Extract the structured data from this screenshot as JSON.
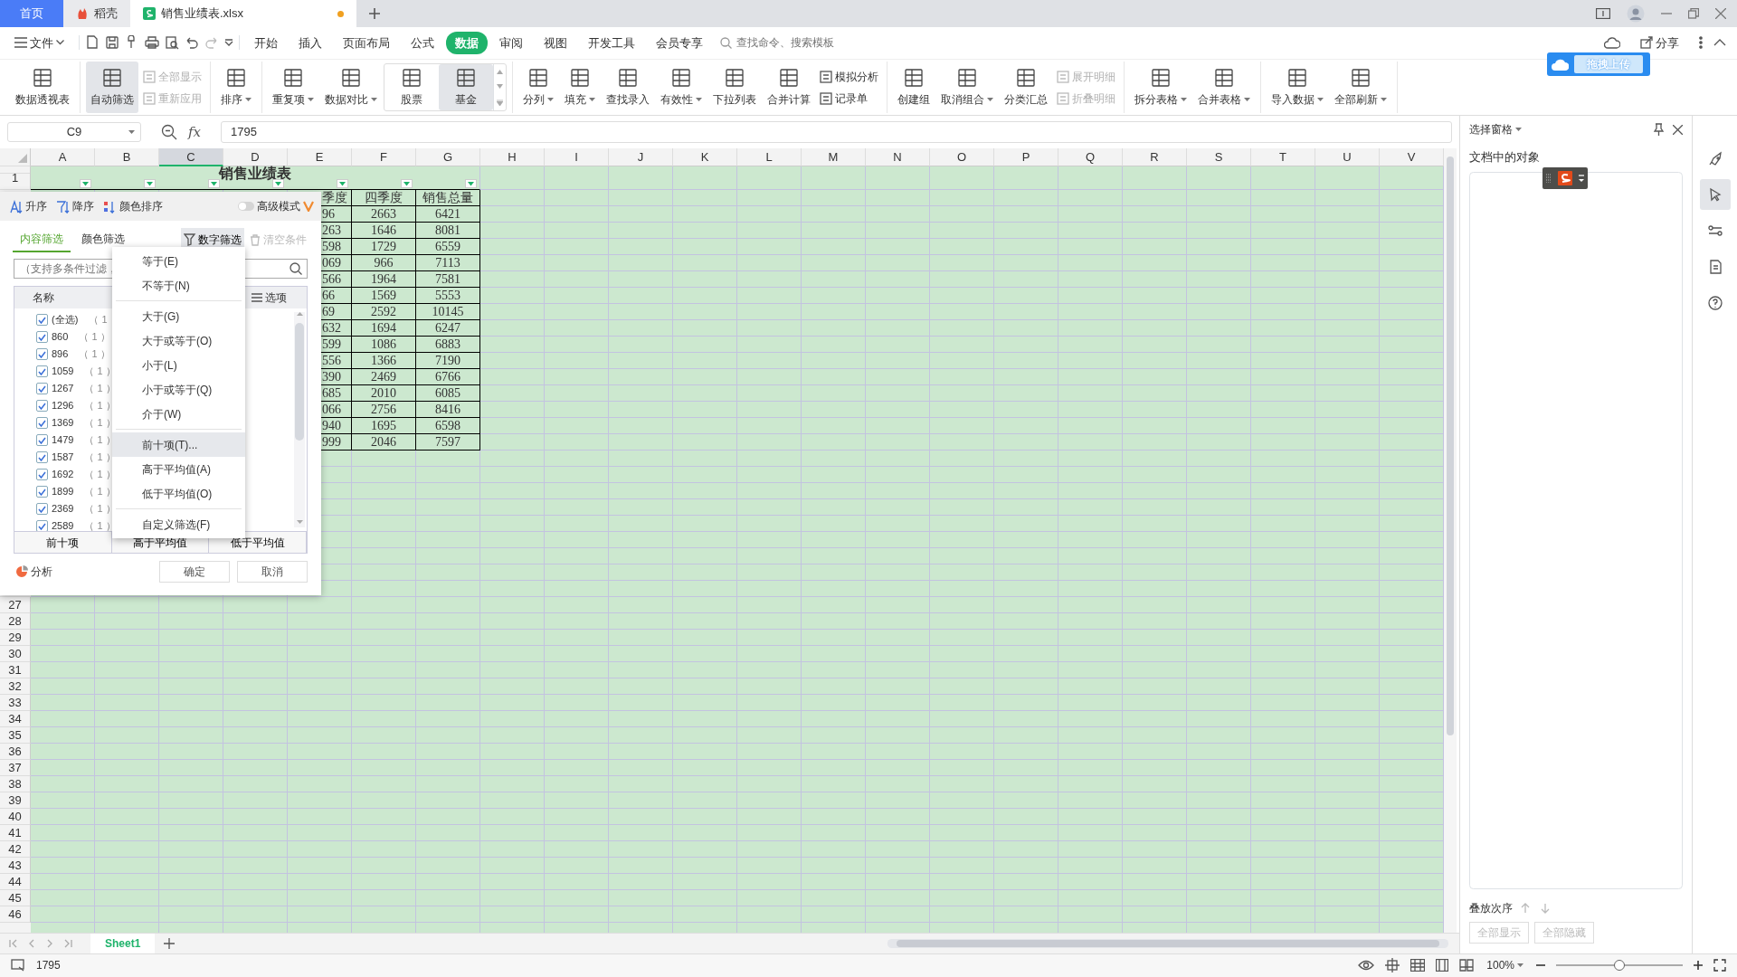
{
  "tabs": [
    {
      "label": "首页",
      "kind": "home",
      "selected": false,
      "unsaved": false
    },
    {
      "label": "稻壳",
      "kind": "docer",
      "selected": false,
      "unsaved": false
    },
    {
      "label": "销售业绩表.xlsx",
      "kind": "sheet",
      "selected": true,
      "unsaved": true
    }
  ],
  "menu": {
    "file": "文件",
    "items": [
      {
        "label": "开始",
        "selected": false
      },
      {
        "label": "插入",
        "selected": false
      },
      {
        "label": "页面布局",
        "selected": false
      },
      {
        "label": "公式",
        "selected": false
      },
      {
        "label": "数据",
        "selected": true
      },
      {
        "label": "审阅",
        "selected": false
      },
      {
        "label": "视图",
        "selected": false
      },
      {
        "label": "开发工具",
        "selected": false
      },
      {
        "label": "会员专享",
        "selected": false
      }
    ],
    "search_placeholder": "查找命令、搜索模板",
    "upload_tip": "拖拽上传",
    "share": "分享"
  },
  "ribbon": [
    [
      {
        "kind": "big",
        "label": "数据透视表",
        "dropdown": false,
        "selected": false
      }
    ],
    [
      {
        "kind": "big",
        "label": "自动筛选",
        "dropdown": false,
        "selected": true
      },
      {
        "kind": "small",
        "label": "全部显示",
        "disabled": true
      },
      {
        "kind": "small",
        "label": "重新应用",
        "disabled": true
      }
    ],
    [
      {
        "kind": "big",
        "label": "排序",
        "dropdown": true,
        "selected": false
      }
    ],
    [
      {
        "kind": "big",
        "label": "重复项",
        "dropdown": true,
        "selected": false
      },
      {
        "kind": "big",
        "label": "数据对比",
        "dropdown": true,
        "selected": false
      },
      {
        "kind": "gallery",
        "label": "股票",
        "selected": false
      },
      {
        "kind": "gallery",
        "label": "基金",
        "selected": true
      }
    ],
    [
      {
        "kind": "big",
        "label": "分列",
        "dropdown": true,
        "selected": false
      },
      {
        "kind": "big",
        "label": "填充",
        "dropdown": true,
        "selected": false
      },
      {
        "kind": "big",
        "label": "查找录入",
        "dropdown": false,
        "selected": false
      },
      {
        "kind": "big",
        "label": "有效性",
        "dropdown": true,
        "selected": false
      },
      {
        "kind": "big",
        "label": "下拉列表",
        "dropdown": false,
        "selected": false
      },
      {
        "kind": "big",
        "label": "合并计算",
        "dropdown": false,
        "selected": false
      },
      {
        "kind": "small",
        "label": "模拟分析",
        "disabled": false
      },
      {
        "kind": "small",
        "label": "记录单",
        "disabled": false
      }
    ],
    [
      {
        "kind": "big",
        "label": "创建组",
        "dropdown": false,
        "selected": false
      },
      {
        "kind": "big",
        "label": "取消组合",
        "dropdown": true,
        "selected": false
      },
      {
        "kind": "big",
        "label": "分类汇总",
        "dropdown": false,
        "selected": false
      },
      {
        "kind": "small",
        "label": "展开明细",
        "disabled": true
      },
      {
        "kind": "small",
        "label": "折叠明细",
        "disabled": true
      }
    ],
    [
      {
        "kind": "big",
        "label": "拆分表格",
        "dropdown": true,
        "selected": false
      },
      {
        "kind": "big",
        "label": "合并表格",
        "dropdown": true,
        "selected": false
      }
    ],
    [
      {
        "kind": "big",
        "label": "导入数据",
        "dropdown": true,
        "selected": false
      },
      {
        "kind": "big",
        "label": "全部刷新",
        "dropdown": true,
        "selected": false
      }
    ]
  ],
  "formula_bar": {
    "cell": "C9",
    "fx_label": "fx",
    "value": "1795"
  },
  "sheet": {
    "columns": [
      {
        "label": "A",
        "selected": false
      },
      {
        "label": "B",
        "selected": false
      },
      {
        "label": "C",
        "selected": true
      },
      {
        "label": "D",
        "selected": false
      },
      {
        "label": "E",
        "selected": false
      },
      {
        "label": "F",
        "selected": false
      },
      {
        "label": "G",
        "selected": false
      },
      {
        "label": "H",
        "selected": false
      },
      {
        "label": "I",
        "selected": false
      },
      {
        "label": "J",
        "selected": false
      },
      {
        "label": "K",
        "selected": false
      },
      {
        "label": "L",
        "selected": false
      },
      {
        "label": "M",
        "selected": false
      },
      {
        "label": "N",
        "selected": false
      },
      {
        "label": "O",
        "selected": false
      },
      {
        "label": "P",
        "selected": false
      },
      {
        "label": "Q",
        "selected": false
      },
      {
        "label": "R",
        "selected": false
      },
      {
        "label": "S",
        "selected": false
      },
      {
        "label": "T",
        "selected": false
      },
      {
        "label": "U",
        "selected": false
      },
      {
        "label": "V",
        "selected": false
      }
    ],
    "row_numbers": [
      "1",
      "27",
      "28",
      "29",
      "30",
      "31",
      "32",
      "33",
      "34",
      "35",
      "36",
      "37",
      "38",
      "39",
      "40",
      "41",
      "42",
      "43",
      "44",
      "45",
      "46"
    ],
    "title": "销售业绩表",
    "table": {
      "header": [
        "季度",
        "四季度",
        "销售总量"
      ],
      "rows": [
        [
          "96",
          "2663",
          "6421"
        ],
        [
          "263",
          "1646",
          "8081"
        ],
        [
          "598",
          "1729",
          "6559"
        ],
        [
          "069",
          "966",
          "7113"
        ],
        [
          "566",
          "1964",
          "7581"
        ],
        [
          "66",
          "1569",
          "5553"
        ],
        [
          "69",
          "2592",
          "10145"
        ],
        [
          "632",
          "1694",
          "6247"
        ],
        [
          "599",
          "1086",
          "6883"
        ],
        [
          "556",
          "1366",
          "7190"
        ],
        [
          "390",
          "2469",
          "6766"
        ],
        [
          "685",
          "2010",
          "6085"
        ],
        [
          "066",
          "2756",
          "8416"
        ],
        [
          "940",
          "1695",
          "6598"
        ],
        [
          "999",
          "2046",
          "7597"
        ]
      ]
    }
  },
  "filter_panel": {
    "sort": [
      "升序",
      "降序",
      "颜色排序"
    ],
    "advanced": {
      "label": "高级模式",
      "on": false
    },
    "tabs": [
      {
        "label": "内容筛选",
        "selected": true
      },
      {
        "label": "颜色筛选",
        "selected": false
      }
    ],
    "number_filter": {
      "label": "数字筛选",
      "active": true
    },
    "clear": {
      "label": "清空条件",
      "disabled": true
    },
    "search_placeholder": "（支持多条件过滤，",
    "list_header": "名称",
    "options": "选项",
    "items": [
      {
        "value": "(全选)",
        "count": "（ 1",
        "checked": true
      },
      {
        "value": "860",
        "count": "（ 1 ）",
        "checked": true
      },
      {
        "value": "896",
        "count": "（ 1 ）",
        "checked": true
      },
      {
        "value": "1059",
        "count": "（ 1 ）",
        "checked": true
      },
      {
        "value": "1267",
        "count": "（ 1 ）",
        "checked": true
      },
      {
        "value": "1296",
        "count": "（ 1 ）",
        "checked": true
      },
      {
        "value": "1369",
        "count": "（ 1 ）",
        "checked": true
      },
      {
        "value": "1479",
        "count": "（ 1 ）",
        "checked": true
      },
      {
        "value": "1587",
        "count": "（ 1 ）",
        "checked": true
      },
      {
        "value": "1692",
        "count": "（ 1 ）",
        "checked": true
      },
      {
        "value": "1899",
        "count": "（ 1 ）",
        "checked": true
      },
      {
        "value": "2369",
        "count": "（ 1 ）",
        "checked": true
      },
      {
        "value": "2589",
        "count": "（ 1 ）",
        "checked": true
      }
    ],
    "quick": [
      "前十项",
      "高于平均值",
      "低于平均值"
    ],
    "analysis": "分析",
    "ok": "确定",
    "cancel": "取消"
  },
  "number_menu": [
    {
      "kind": "item",
      "label": "等于(E)",
      "selected": false
    },
    {
      "kind": "item",
      "label": "不等于(N)",
      "selected": false
    },
    {
      "kind": "separator"
    },
    {
      "kind": "item",
      "label": "大于(G)",
      "selected": false
    },
    {
      "kind": "item",
      "label": "大于或等于(O)",
      "selected": false
    },
    {
      "kind": "item",
      "label": "小于(L)",
      "selected": false
    },
    {
      "kind": "item",
      "label": "小于或等于(Q)",
      "selected": false
    },
    {
      "kind": "item",
      "label": "介于(W)",
      "selected": false
    },
    {
      "kind": "separator"
    },
    {
      "kind": "item",
      "label": "前十项(T)...",
      "selected": true
    },
    {
      "kind": "item",
      "label": "高于平均值(A)",
      "selected": false
    },
    {
      "kind": "item",
      "label": "低于平均值(O)",
      "selected": false
    },
    {
      "kind": "separator"
    },
    {
      "kind": "item",
      "label": "自定义筛选(F)",
      "selected": false
    }
  ],
  "selection_pane": {
    "title": "选择窗格",
    "objects_label": "文档中的对象",
    "order_label": "叠放次序",
    "buttons": [
      {
        "label": "全部显示",
        "disabled": true
      },
      {
        "label": "全部隐藏",
        "disabled": true
      }
    ]
  },
  "side_tools": [
    {
      "kind": "rocket",
      "selected": false
    },
    {
      "kind": "cursor",
      "selected": true
    },
    {
      "kind": "sliders",
      "selected": false
    },
    {
      "kind": "document",
      "selected": false
    },
    {
      "kind": "help",
      "selected": false
    }
  ],
  "sheet_tabs": [
    {
      "label": "Sheet1",
      "selected": true
    }
  ],
  "status_bar": {
    "value": "1795",
    "zoom": "100%",
    "zoom_slider": {
      "level": 0.5
    }
  }
}
